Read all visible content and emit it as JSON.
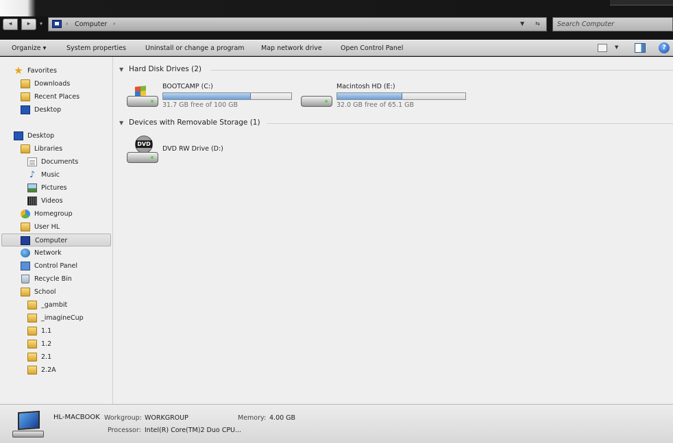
{
  "address": {
    "crumbs": [
      "Computer"
    ],
    "search_placeholder": "Search Computer"
  },
  "toolbar": {
    "organize": "Organize ▾",
    "system_properties": "System properties",
    "uninstall": "Uninstall or change a program",
    "map_drive": "Map network drive",
    "control_panel": "Open Control Panel",
    "help": "?"
  },
  "nav": {
    "favorites": "Favorites",
    "downloads": "Downloads",
    "recent_places": "Recent Places",
    "desktop_fav": "Desktop",
    "desktop": "Desktop",
    "libraries": "Libraries",
    "documents": "Documents",
    "music": "Music",
    "pictures": "Pictures",
    "videos": "Videos",
    "homegroup": "Homegroup",
    "user": "User HL",
    "computer": "Computer",
    "network": "Network",
    "control_panel": "Control Panel",
    "recycle_bin": "Recycle Bin",
    "school": "School",
    "gambit": "_gambit",
    "imaginecup": "_imagineCup",
    "f11": "1.1",
    "f12": "1.2",
    "f21": "2.1",
    "f22a": "2.2A"
  },
  "groups": {
    "hdd": "Hard Disk Drives (2)",
    "removable": "Devices with Removable Storage (1)"
  },
  "drives": {
    "c": {
      "name": "BOOTCAMP (C:)",
      "free": "31.7 GB free of 100 GB",
      "used_fraction": 0.683
    },
    "e": {
      "name": "Macintosh HD (E:)",
      "free": "32.0 GB free of 65.1 GB",
      "used_fraction": 0.508
    },
    "d": {
      "name": "DVD RW Drive (D:)",
      "badge": "DVD"
    }
  },
  "details": {
    "name": "HL-MACBOOK",
    "workgroup_label": "Workgroup:",
    "workgroup": "WORKGROUP",
    "memory_label": "Memory:",
    "memory": "4.00 GB",
    "processor_label": "Processor:",
    "processor": "Intel(R) Core(TM)2 Duo CPU..."
  }
}
